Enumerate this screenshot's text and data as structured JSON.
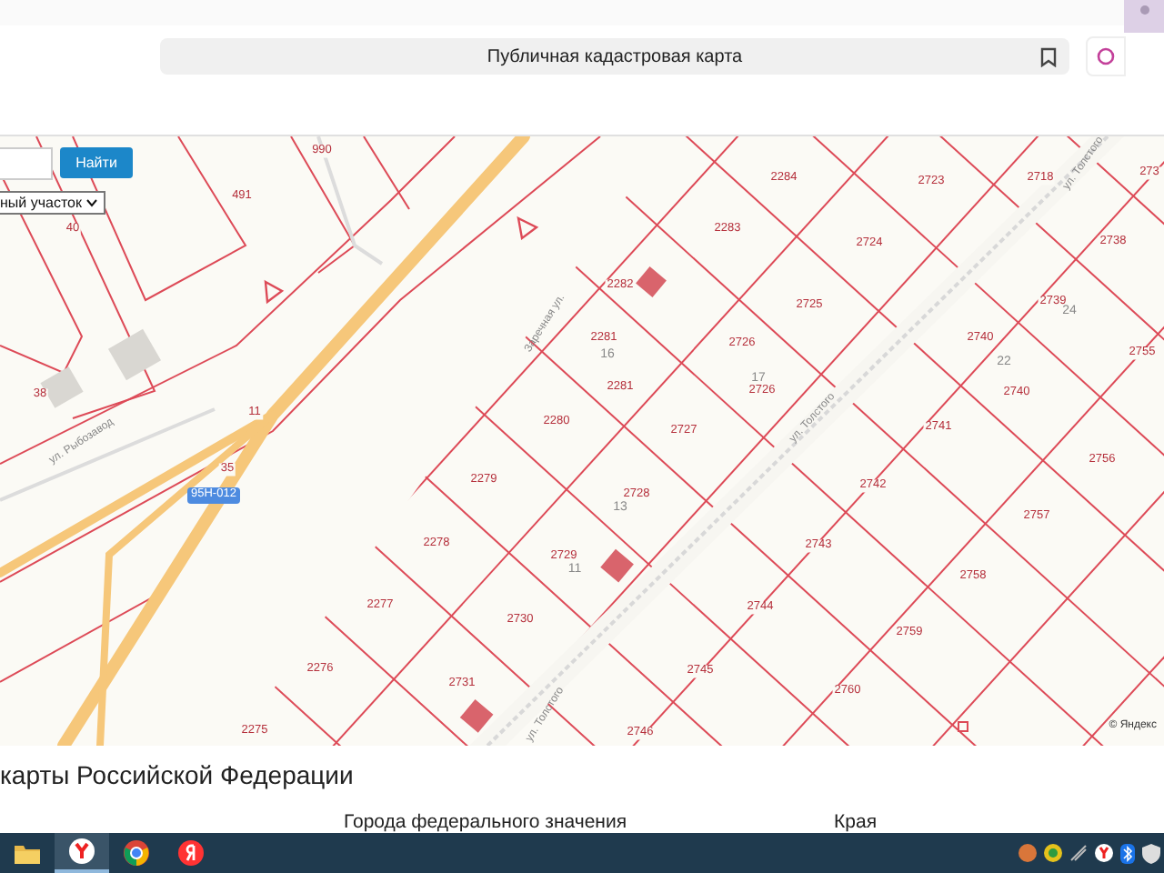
{
  "browser": {
    "page_title": "Публичная кадастровая карта"
  },
  "search": {
    "button": "Найти",
    "filter_value": "ный участок"
  },
  "map": {
    "parcels": [
      "990",
      "491",
      "40",
      "38",
      "11",
      "35",
      "2284",
      "2723",
      "2718",
      "273",
      "2738",
      "2283",
      "2724",
      "2282",
      "2725",
      "2739",
      "2281",
      "2726",
      "2740",
      "2755",
      "2281",
      "2726",
      "2740",
      "2727",
      "2741",
      "2280",
      "2756",
      "2279",
      "2728",
      "2742",
      "2757",
      "2278",
      "2729",
      "2743",
      "2758",
      "2277",
      "2730",
      "2744",
      "2759",
      "2276",
      "2731",
      "2745",
      "2760",
      "2275",
      "2746"
    ],
    "house_numbers": [
      "16",
      "17",
      "22",
      "24",
      "13",
      "11"
    ],
    "streets": [
      "ул. Рыбозавод",
      "Заречная ул.",
      "ул. Толстого",
      "ул. Толстого",
      "ул. Толстого"
    ],
    "road_badge": "95Н-012",
    "attribution": "© Яндекс"
  },
  "section": {
    "heading": "карты Российской Федерации",
    "columns": [
      "Города федерального значения",
      "Края"
    ]
  },
  "taskbar": {
    "apps": [
      {
        "kind": "folder",
        "selected": false
      },
      {
        "kind": "yandex-browser",
        "selected": true
      },
      {
        "kind": "chrome",
        "selected": false
      },
      {
        "kind": "yandex",
        "selected": false
      }
    ]
  }
}
